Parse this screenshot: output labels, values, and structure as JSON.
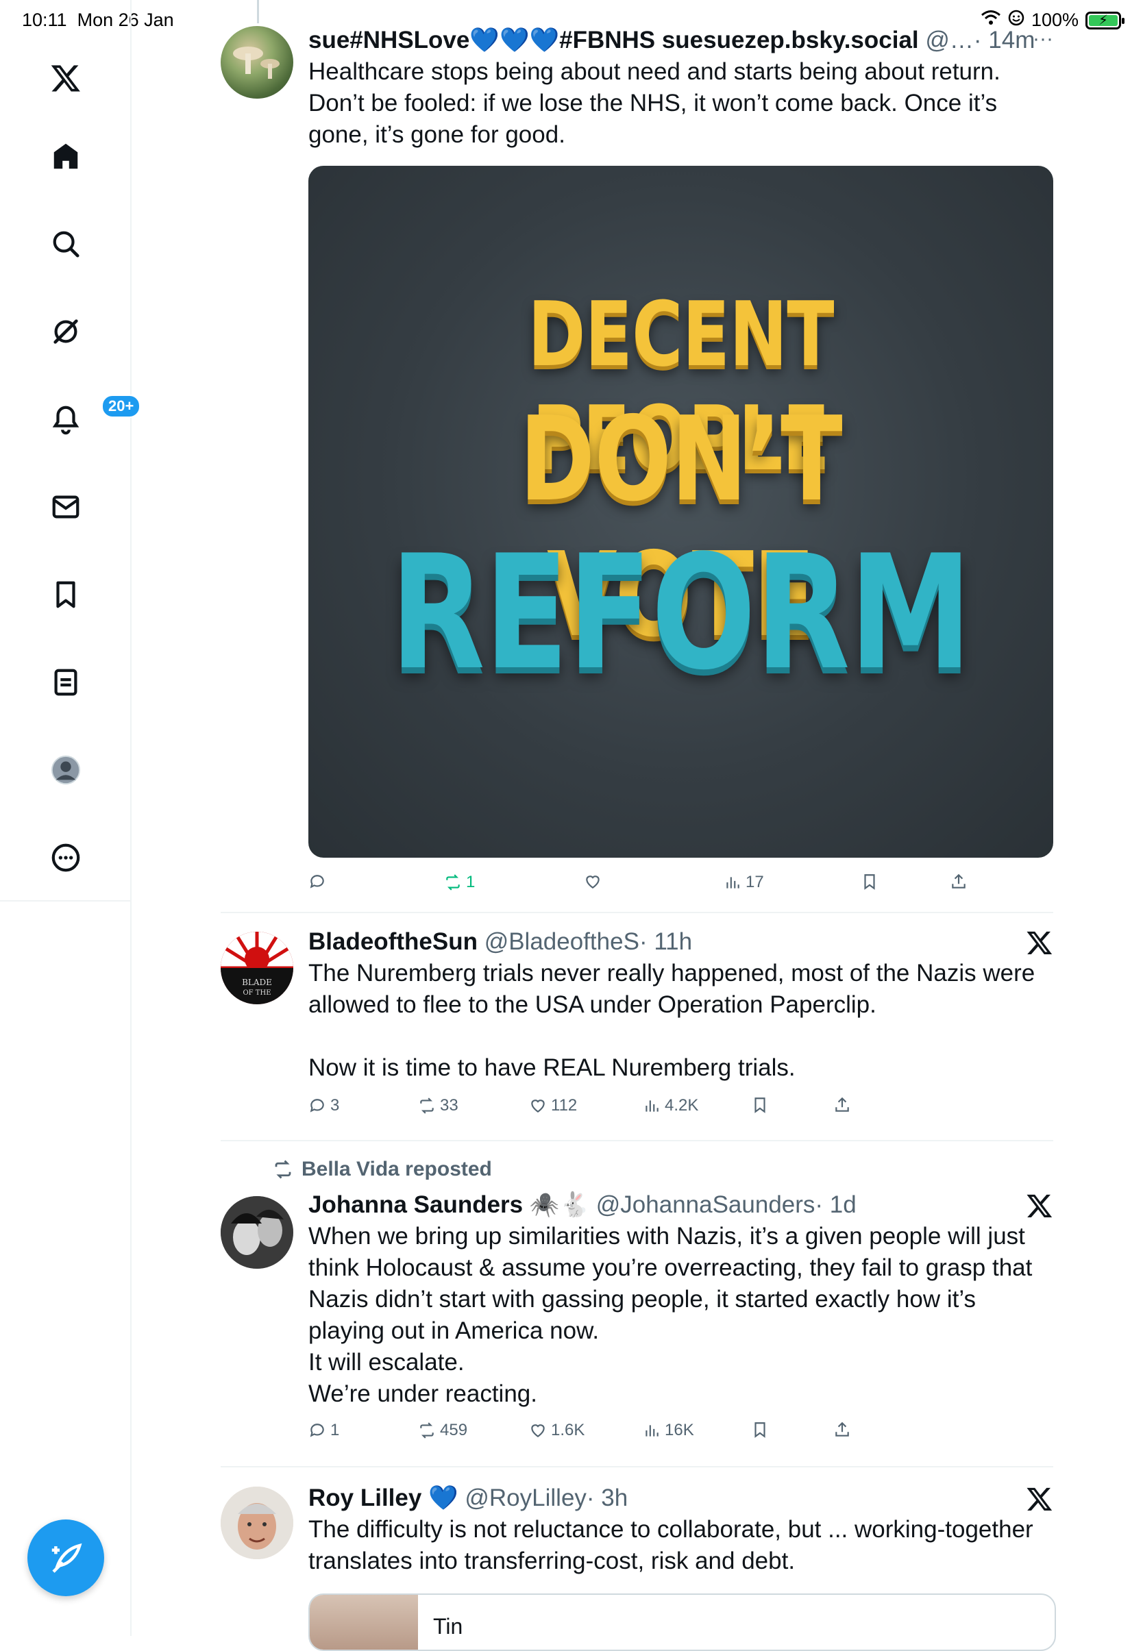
{
  "status_bar": {
    "time": "10:11",
    "date": "Mon 26 Jan",
    "battery": "100%",
    "battery_level": 100
  },
  "sidebar": {
    "items": [
      {
        "name": "x-logo"
      },
      {
        "name": "home"
      },
      {
        "name": "search"
      },
      {
        "name": "grok"
      },
      {
        "name": "notifications",
        "badge": "20+"
      },
      {
        "name": "messages"
      },
      {
        "name": "bookmarks"
      },
      {
        "name": "lists"
      },
      {
        "name": "profile"
      },
      {
        "name": "more"
      }
    ]
  },
  "posts": [
    {
      "name": "sue#NHSLove💙💙💙#FBNHS suesuezep.bsky.social",
      "handle": "@…",
      "time": "· 14m",
      "text": "Healthcare stops being about need and starts being about return.\nDon’t be fooled: if we lose the NHS, it won’t come back. Once it’s gone, it’s gone for good.",
      "media_text": [
        "DECENT PEOPLE",
        "DON’T VOTE",
        "REFORM"
      ],
      "replies": "",
      "reposts": "1",
      "likes": "",
      "views": "17"
    },
    {
      "name": "BladeoftheSun",
      "handle": "@BladeoftheS",
      "time": "· 11h",
      "text": "The Nuremberg trials never really happened, most of the Nazis were allowed to flee to the USA under Operation Paperclip.\n\nNow it is time to have REAL Nuremberg trials.",
      "replies": "3",
      "reposts": "33",
      "likes": "112",
      "views": "4.2K"
    },
    {
      "repost_label": "Bella Vida reposted",
      "name": "Johanna Saunders 🕷️🐇",
      "handle": "@JohannaSaunders",
      "time": "· 1d",
      "text": "When we bring up similarities with Nazis, it’s a given people will just think Holocaust & assume you’re overreacting, they fail to grasp that Nazis didn’t start with gassing people, it started exactly how it’s playing out in America now.\nIt will escalate.\nWe’re under reacting.",
      "replies": "1",
      "reposts": "459",
      "likes": "1.6K",
      "views": "16K"
    },
    {
      "name": "Roy Lilley 💙",
      "handle": "@RoyLilley",
      "time": "· 3h",
      "text": "The difficulty is not reluctance to collaborate, but ... working-together translates into transferring-cost, risk and debt.",
      "card_text": "Tin"
    }
  ],
  "colors": {
    "accent": "#1d9bf0",
    "repost_active": "#00ba7c",
    "secondary_text": "#536471"
  }
}
